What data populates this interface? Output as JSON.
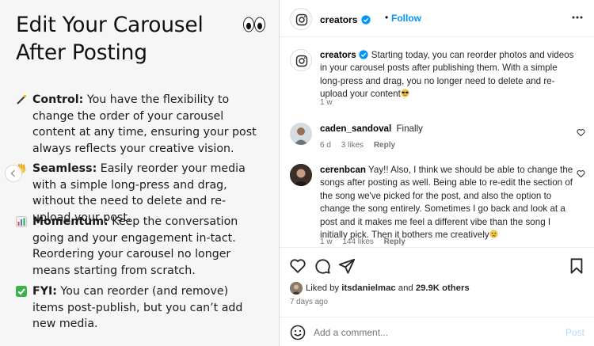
{
  "slide": {
    "title": "Edit Your Carousel After Posting",
    "points": [
      {
        "emoji": "wand-emoji",
        "label": "Control:",
        "text": " You have the flexibility to change the order of your carousel content at any time, ensuring your post always reflects your creative vision."
      },
      {
        "emoji": "hand-emoji",
        "label": "Seamless:",
        "text": " Easily reorder your media with a simple long-press and drag, without the need to delete and re-upload your post."
      },
      {
        "emoji": "chart-emoji",
        "label": "Momentum:",
        "text": " Keep the conversation going and your engagement in-tact. Reordering your carousel no longer means starting from scratch."
      },
      {
        "emoji": "check-emoji",
        "label": "FYI:",
        "text": " You can reorder (and remove) items post-publish, but you can’t add new media."
      }
    ]
  },
  "post": {
    "author": "creators",
    "dot": "•",
    "follow_label": "Follow",
    "caption": {
      "author": "creators",
      "text": "Starting today, you can reorder photos and videos in your carousel posts after publishing them. With a simple long-press and drag, you no longer need to delete and re-upload your content",
      "age": "1 w"
    },
    "comments": [
      {
        "user": "caden_sandoval",
        "text": "Finally",
        "age": "6 d",
        "likes": "3 likes",
        "reply": "Reply"
      },
      {
        "user": "cerenbcan",
        "text": "Yay!! Also, I think we should be able to change the songs after posting as well. Being able to re-edit the section of the song we've picked for the post, and also the option to change the song entirely. Sometimes I go back and look at a post and it makes me feel a different vibe than the song I initially pick. Then it bothers me creatively",
        "age": "1 w",
        "likes": "144 likes",
        "reply": "Reply"
      }
    ],
    "likes": {
      "prefix": "Liked by ",
      "user": "itsdanielmac",
      "middle": " and ",
      "count": "29.9K others"
    },
    "posted_age": "7 days ago",
    "add_comment_placeholder": "Add a comment...",
    "post_label": "Post"
  },
  "colors": {
    "accent": "#0095f6",
    "post_disabled": "#b3dbff",
    "muted": "#737373",
    "slide_bg": "#f6f6f6"
  }
}
